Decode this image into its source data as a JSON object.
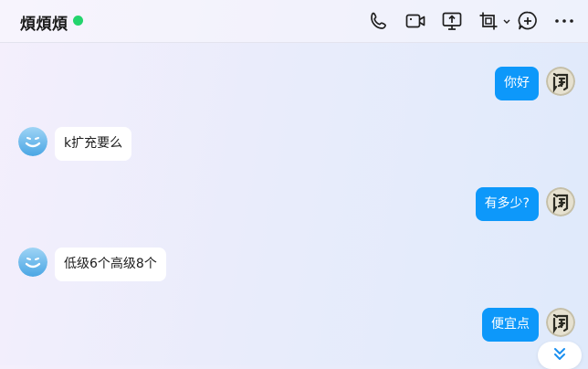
{
  "header": {
    "contact_name": "煩煩煩",
    "online_color": "#24d46d",
    "toolbar_icons": [
      "phone-icon",
      "video-call-icon",
      "screen-share-icon",
      "screenshot-icon",
      "chevron-down-icon",
      "add-icon",
      "more-icon"
    ]
  },
  "messages": [
    {
      "side": "out",
      "text": "你好"
    },
    {
      "side": "in",
      "text": "k扩充要么"
    },
    {
      "side": "out",
      "text": "有多少?"
    },
    {
      "side": "in",
      "text": "低级6个高级8个"
    },
    {
      "side": "out",
      "text": "便宜点"
    }
  ],
  "colors": {
    "outgoing_bubble": "#0d98fa",
    "incoming_bubble": "#ffffff"
  },
  "scroll_button": {
    "icon": "double-chevron-down-icon"
  }
}
